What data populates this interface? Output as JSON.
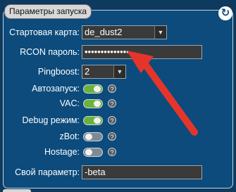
{
  "panel": {
    "title": "Параметры запуска",
    "refresh_icon": "refresh-icon"
  },
  "start_map": {
    "label": "Стартовая карта:",
    "value": "de_dust2"
  },
  "rcon": {
    "label": "RCON пароль:",
    "value": "••••••••••••••"
  },
  "pingboost": {
    "label": "Pingboost:",
    "value": "2"
  },
  "toggles": [
    {
      "label": "Автозапуск:",
      "state": "on"
    },
    {
      "label": "VAC:",
      "state": "on"
    },
    {
      "label": "Debug режим:",
      "state": "on"
    },
    {
      "label": "zBot:",
      "state": "off"
    },
    {
      "label": "Hostage:",
      "state": "off"
    }
  ],
  "custom_param": {
    "label": "Свой параметр:",
    "value": "-beta"
  },
  "help_glyph": "?",
  "colors": {
    "accent_on": "#6ab33a",
    "arrow": "#e5352b",
    "panel_bg": "#0c4b7c"
  }
}
